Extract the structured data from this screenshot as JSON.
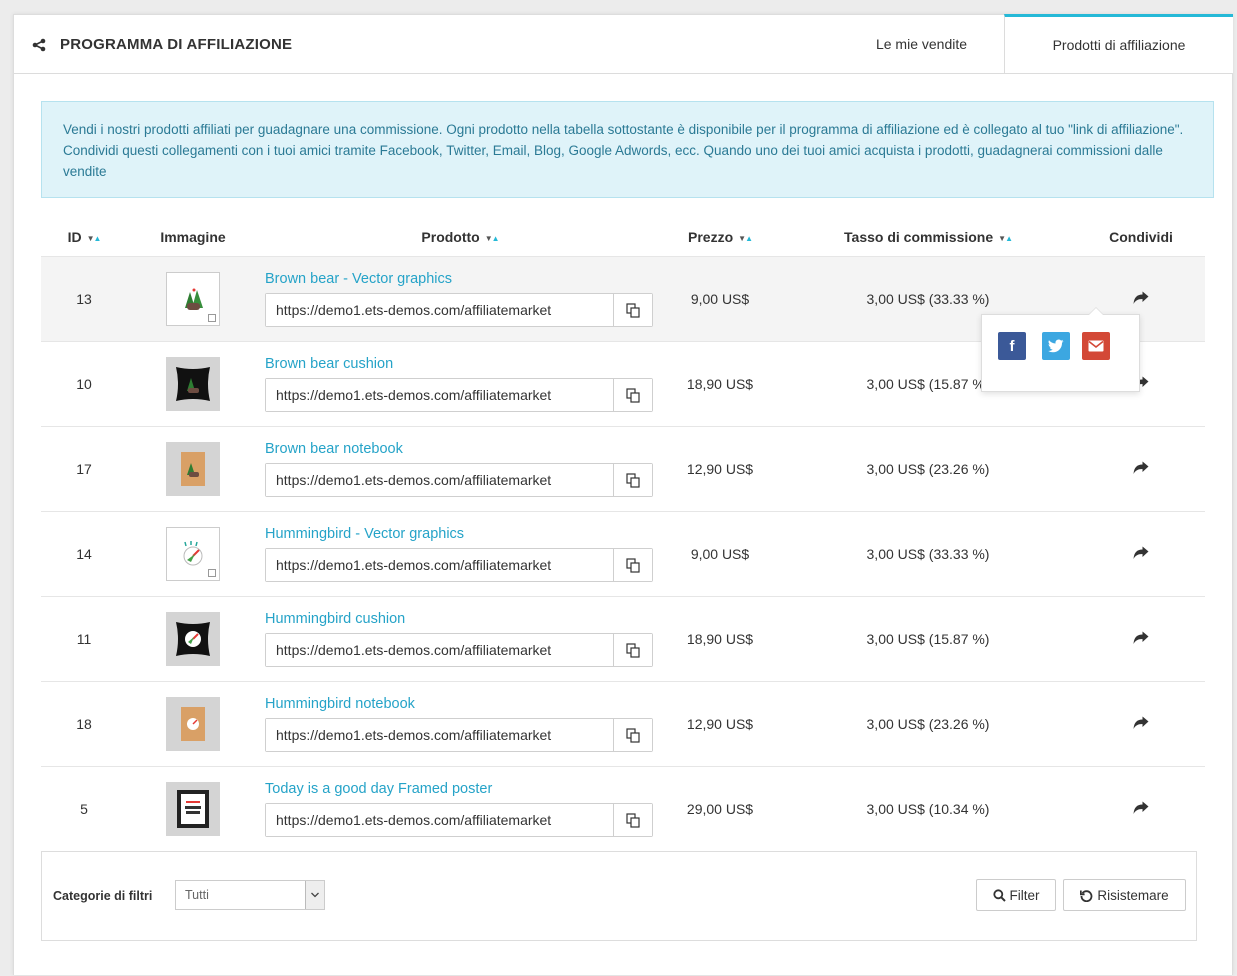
{
  "header": {
    "title": "PROGRAMMA DI AFFILIAZIONE",
    "icon": "share-icon",
    "tabs": [
      {
        "label": "Le mie vendite",
        "active": false
      },
      {
        "label": "Prodotti di affiliazione",
        "active": true
      }
    ]
  },
  "notice": {
    "text": "Vendi i nostri prodotti affiliati per guadagnare una commissione. Ogni prodotto nella tabella sottostante è disponibile per il programma di affiliazione ed è collegato al tuo \"link di affiliazione\". Condividi questi collegamenti con i tuoi amici tramite Facebook, Twitter, Email, Blog, Google Adwords, ecc. Quando uno dei tuoi amici acquista i prodotti, guadagnerai commissioni dalle vendite"
  },
  "table": {
    "columns": [
      "ID",
      "Immagine",
      "Prodotto",
      "Prezzo",
      "Tasso di commissione",
      "Condividi"
    ],
    "rows": [
      {
        "id": "13",
        "name": "Brown bear - Vector graphics",
        "url": "https://demo1.ets-demos.com/affiliatemarket",
        "price": "9,00 US$",
        "rate": "3,00 US$ (33.33 %)",
        "thumb": "bear-vector"
      },
      {
        "id": "10",
        "name": "Brown bear cushion",
        "url": "https://demo1.ets-demos.com/affiliatemarket",
        "price": "18,90 US$",
        "rate": "3,00 US$ (15.87 %)",
        "thumb": "bear-cushion"
      },
      {
        "id": "17",
        "name": "Brown bear notebook",
        "url": "https://demo1.ets-demos.com/affiliatemarket",
        "price": "12,90 US$",
        "rate": "3,00 US$ (23.26 %)",
        "thumb": "bear-notebook"
      },
      {
        "id": "14",
        "name": "Hummingbird - Vector graphics",
        "url": "https://demo1.ets-demos.com/affiliatemarket",
        "price": "9,00 US$",
        "rate": "3,00 US$ (33.33 %)",
        "thumb": "bird-vector"
      },
      {
        "id": "11",
        "name": "Hummingbird cushion",
        "url": "https://demo1.ets-demos.com/affiliatemarket",
        "price": "18,90 US$",
        "rate": "3,00 US$ (15.87 %)",
        "thumb": "bird-cushion"
      },
      {
        "id": "18",
        "name": "Hummingbird notebook",
        "url": "https://demo1.ets-demos.com/affiliatemarket",
        "price": "12,90 US$",
        "rate": "3,00 US$ (23.26 %)",
        "thumb": "bird-notebook"
      },
      {
        "id": "5",
        "name": "Today is a good day Framed poster",
        "url": "https://demo1.ets-demos.com/affiliatemarket",
        "price": "29,00 US$",
        "rate": "3,00 US$ (10.34 %)",
        "thumb": "poster"
      }
    ]
  },
  "share_popover": {
    "buttons": [
      {
        "icon": "facebook-icon",
        "glyph": "f",
        "color": "#3b5998"
      },
      {
        "icon": "twitter-icon",
        "glyph": "t",
        "color": "#3ca7e1"
      },
      {
        "icon": "email-icon",
        "glyph": "✉",
        "color": "#d34836"
      }
    ]
  },
  "filter": {
    "label": "Categorie di filtri",
    "selected": "Tutti",
    "filter_button": "Filter",
    "reset_button": "Risistemare"
  },
  "colors": {
    "accent": "#25b9d7",
    "link": "#25a3c8",
    "notice_bg": "#dff3f9",
    "notice_text": "#2b7a95"
  }
}
